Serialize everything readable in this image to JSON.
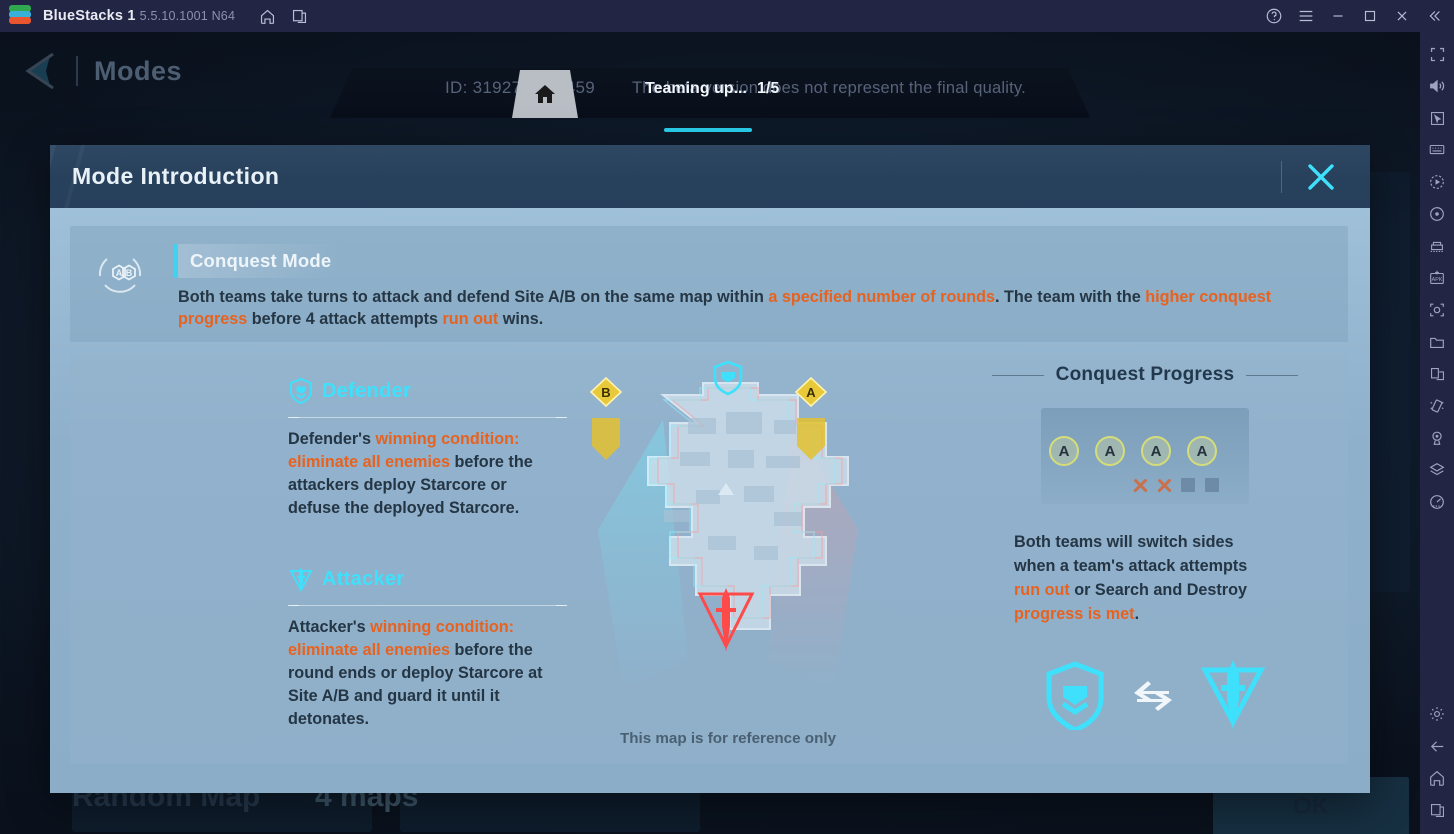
{
  "titlebar": {
    "app_name": "BlueStacks 1",
    "version": "5.5.10.1001 N64",
    "icons": {
      "logo": "bluestacks-logo",
      "home": "home-icon",
      "instances": "multi-instance-icon",
      "help": "help-icon",
      "menu": "hamburger-menu-icon",
      "minimize": "minimize-icon",
      "maximize": "maximize-icon",
      "close": "close-icon",
      "collapse": "collapse-icon"
    }
  },
  "sidebar": {
    "items": [
      {
        "name": "fullscreen-icon",
        "label": "Fullscreen"
      },
      {
        "name": "volume-icon",
        "label": "Volume"
      },
      {
        "name": "cursor-icon",
        "label": "Cursor"
      },
      {
        "name": "keyboard-icon",
        "label": "Game controls"
      },
      {
        "name": "macro-icon",
        "label": "Macro recorder"
      },
      {
        "name": "eco-mode-icon",
        "label": "Eco mode"
      },
      {
        "name": "multi-instance-icon",
        "label": "Multi-instance manager"
      },
      {
        "name": "install-apk-icon",
        "label": "Install APK"
      },
      {
        "name": "screenshot-icon",
        "label": "Screenshot"
      },
      {
        "name": "media-folder-icon",
        "label": "Media manager"
      },
      {
        "name": "copy-window-icon",
        "label": "Copy to clipboard"
      },
      {
        "name": "shake-icon",
        "label": "Shake"
      },
      {
        "name": "location-icon",
        "label": "Location"
      },
      {
        "name": "layers-icon",
        "label": "Layers"
      },
      {
        "name": "performance-icon",
        "label": "Performance"
      }
    ],
    "bottom_items": [
      {
        "name": "settings-gear-icon",
        "label": "Settings"
      },
      {
        "name": "back-icon",
        "label": "Back"
      },
      {
        "name": "home-icon",
        "label": "Home"
      },
      {
        "name": "recents-icon",
        "label": "Recents"
      }
    ]
  },
  "game_background": {
    "back_label": "Modes",
    "session_id": "ID: 31927…—0459",
    "beta_notice": "The beta version does not represent the final quality.",
    "teaming_label": "Teaming up...",
    "teaming_count": "1/5",
    "random_map_label": "Random Map",
    "maps_count_label": "4 maps",
    "ok_label": "OK"
  },
  "dialog": {
    "title": "Mode Introduction",
    "close_icon": "close-icon",
    "mode": {
      "icon": "site-ab-icon",
      "name": "Conquest Mode",
      "description_parts": [
        {
          "text": "Both teams take turns to attack and defend Site A/B on the same map within ",
          "highlight": false
        },
        {
          "text": "a specified number of rounds",
          "highlight": true
        },
        {
          "text": ". The team with the ",
          "highlight": false
        },
        {
          "text": "higher conquest progress",
          "highlight": true
        },
        {
          "text": " before 4 attack attempts ",
          "highlight": false
        },
        {
          "text": "run out",
          "highlight": true
        },
        {
          "text": " wins.",
          "highlight": false
        }
      ]
    },
    "defender": {
      "icon": "shield-defender-icon",
      "title": "Defender",
      "description_parts": [
        {
          "text": "Defender's ",
          "highlight": false
        },
        {
          "text": "winning condition: eliminate all enemies",
          "highlight": true
        },
        {
          "text": " before the attackers deploy Starcore or defuse the deployed Starcore.",
          "highlight": false
        }
      ]
    },
    "attacker": {
      "icon": "dagger-attacker-icon",
      "title": "Attacker",
      "description_parts": [
        {
          "text": "Attacker's ",
          "highlight": false
        },
        {
          "text": "winning condition: eliminate all enemies",
          "highlight": true
        },
        {
          "text": " before the round ends or deploy Starcore at Site A/B and guard it until it detonates.",
          "highlight": false
        }
      ]
    },
    "map": {
      "caption": "This map is for reference only",
      "site_b_label": "B",
      "site_a_label": "A",
      "defender_spawn_icon": "defender-spawn-icon",
      "attacker_spawn_icon": "attacker-spawn-icon"
    },
    "conquest_progress": {
      "title": "Conquest Progress",
      "round_labels": [
        "A",
        "A",
        "A",
        "A"
      ],
      "markers": [
        "x",
        "x",
        "square",
        "square"
      ],
      "description_parts": [
        {
          "text": "Both teams will switch sides when a team's attack attempts ",
          "highlight": false
        },
        {
          "text": "run out",
          "highlight": true
        },
        {
          "text": " or Search and Destroy ",
          "highlight": false
        },
        {
          "text": "progress is met",
          "highlight": true
        },
        {
          "text": ".",
          "highlight": false
        }
      ],
      "swap_left_icon": "shield-defender-icon",
      "swap_arrows_icon": "swap-arrows-icon",
      "swap_right_icon": "dagger-attacker-icon"
    }
  },
  "colors": {
    "accent_cyan": "#3fe0fb",
    "highlight_orange": "#e8621f",
    "dialog_header": "#2a4260",
    "dialog_body": "#8fb0cb",
    "titlebar": "#232544",
    "site_marker_yellow": "#d5dd78"
  }
}
